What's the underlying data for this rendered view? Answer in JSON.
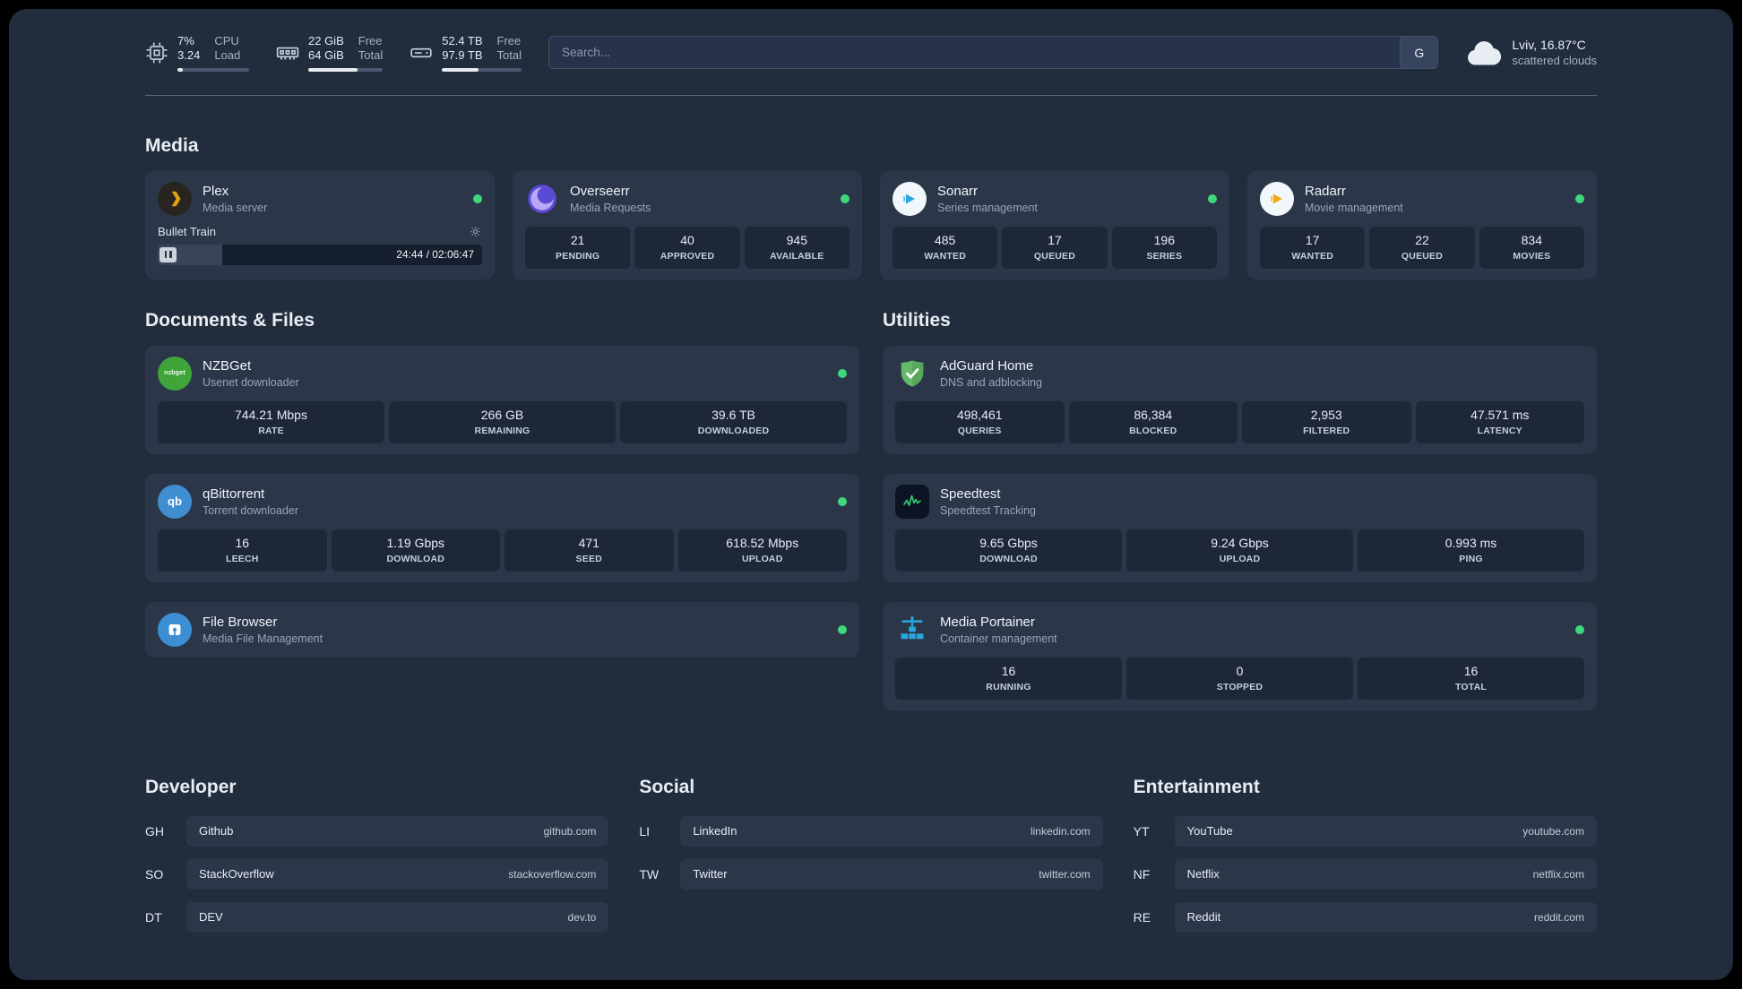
{
  "colors": {
    "status_online": "#3fd77c",
    "accent_plex": "#e5a00d",
    "accent_overseerr": "#5b4ad4",
    "accent_sonarr": "#29a8e0",
    "accent_radarr": "#f3a712",
    "accent_nzbget": "#3fa53b",
    "accent_qbittorrent": "#3f8fd0",
    "accent_filebrowser": "#3c8fd4",
    "accent_adguard": "#66b96a",
    "accent_speedtest": "#2ecc71",
    "accent_portainer": "#29a8e0"
  },
  "topbar": {
    "cpu": {
      "percent": "7%",
      "load": "3.24",
      "label_top": "CPU",
      "label_bottom": "Load",
      "bar_pct": 7
    },
    "memory": {
      "free": "22 GiB",
      "total": "64 GiB",
      "label_top": "Free",
      "label_bottom": "Total",
      "bar_pct": 66
    },
    "disk": {
      "free": "52.4 TB",
      "total": "97.9 TB",
      "label_top": "Free",
      "label_bottom": "Total",
      "bar_pct": 46
    },
    "search": {
      "placeholder": "Search...",
      "provider_button": "G"
    },
    "weather": {
      "location": "Lviv, 16.87°C",
      "condition": "scattered clouds"
    }
  },
  "media": {
    "title": "Media",
    "plex": {
      "name": "Plex",
      "subtitle": "Media server",
      "now_playing": "Bullet Train",
      "time": "24:44 / 02:06:47",
      "progress_pct": 20
    },
    "overseerr": {
      "name": "Overseerr",
      "subtitle": "Media Requests",
      "stats": [
        {
          "value": "21",
          "label": "PENDING"
        },
        {
          "value": "40",
          "label": "APPROVED"
        },
        {
          "value": "945",
          "label": "AVAILABLE"
        }
      ]
    },
    "sonarr": {
      "name": "Sonarr",
      "subtitle": "Series management",
      "stats": [
        {
          "value": "485",
          "label": "WANTED"
        },
        {
          "value": "17",
          "label": "QUEUED"
        },
        {
          "value": "196",
          "label": "SERIES"
        }
      ]
    },
    "radarr": {
      "name": "Radarr",
      "subtitle": "Movie management",
      "stats": [
        {
          "value": "17",
          "label": "WANTED"
        },
        {
          "value": "22",
          "label": "QUEUED"
        },
        {
          "value": "834",
          "label": "MOVIES"
        }
      ]
    }
  },
  "documents": {
    "title": "Documents & Files",
    "nzbget": {
      "name": "NZBGet",
      "subtitle": "Usenet downloader",
      "stats": [
        {
          "value": "744.21 Mbps",
          "label": "RATE"
        },
        {
          "value": "266 GB",
          "label": "REMAINING"
        },
        {
          "value": "39.6 TB",
          "label": "DOWNLOADED"
        }
      ]
    },
    "qbittorrent": {
      "name": "qBittorrent",
      "subtitle": "Torrent downloader",
      "stats": [
        {
          "value": "16",
          "label": "LEECH"
        },
        {
          "value": "1.19 Gbps",
          "label": "DOWNLOAD"
        },
        {
          "value": "471",
          "label": "SEED"
        },
        {
          "value": "618.52 Mbps",
          "label": "UPLOAD"
        }
      ]
    },
    "filebrowser": {
      "name": "File Browser",
      "subtitle": "Media File Management"
    }
  },
  "utilities": {
    "title": "Utilities",
    "adguard": {
      "name": "AdGuard Home",
      "subtitle": "DNS and adblocking",
      "stats": [
        {
          "value": "498,461",
          "label": "QUERIES"
        },
        {
          "value": "86,384",
          "label": "BLOCKED"
        },
        {
          "value": "2,953",
          "label": "FILTERED"
        },
        {
          "value": "47.571 ms",
          "label": "LATENCY"
        }
      ]
    },
    "speedtest": {
      "name": "Speedtest",
      "subtitle": "Speedtest Tracking",
      "stats": [
        {
          "value": "9.65 Gbps",
          "label": "DOWNLOAD"
        },
        {
          "value": "9.24 Gbps",
          "label": "UPLOAD"
        },
        {
          "value": "0.993 ms",
          "label": "PING"
        }
      ]
    },
    "portainer": {
      "name": "Media Portainer",
      "subtitle": "Container management",
      "stats": [
        {
          "value": "16",
          "label": "RUNNING"
        },
        {
          "value": "0",
          "label": "STOPPED"
        },
        {
          "value": "16",
          "label": "TOTAL"
        }
      ]
    }
  },
  "bookmarks": {
    "developer": {
      "title": "Developer",
      "items": [
        {
          "abbr": "GH",
          "name": "Github",
          "url": "github.com"
        },
        {
          "abbr": "SO",
          "name": "StackOverflow",
          "url": "stackoverflow.com"
        },
        {
          "abbr": "DT",
          "name": "DEV",
          "url": "dev.to"
        }
      ]
    },
    "social": {
      "title": "Social",
      "items": [
        {
          "abbr": "LI",
          "name": "LinkedIn",
          "url": "linkedin.com"
        },
        {
          "abbr": "TW",
          "name": "Twitter",
          "url": "twitter.com"
        }
      ]
    },
    "entertainment": {
      "title": "Entertainment",
      "items": [
        {
          "abbr": "YT",
          "name": "YouTube",
          "url": "youtube.com"
        },
        {
          "abbr": "NF",
          "name": "Netflix",
          "url": "netflix.com"
        },
        {
          "abbr": "RE",
          "name": "Reddit",
          "url": "reddit.com"
        }
      ]
    }
  },
  "icons": {
    "cpu": "cpu-chip-icon",
    "memory": "ram-icon",
    "disk": "hard-disk-icon",
    "weather": "cloud-icon",
    "plex_settings": "gear-icon",
    "plex_playback": "pause-icon",
    "status": "online-dot"
  }
}
